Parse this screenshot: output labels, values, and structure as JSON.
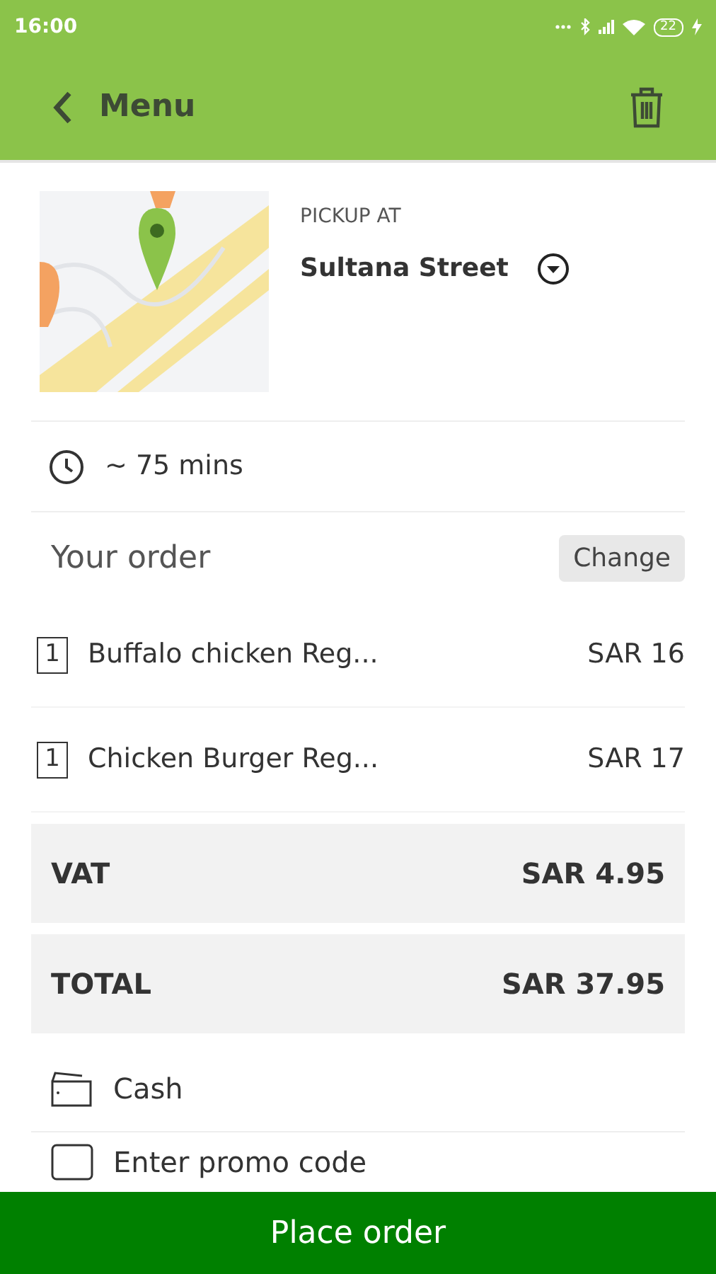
{
  "status_bar": {
    "time": "16:00",
    "battery": "22"
  },
  "header": {
    "back_label": "Menu"
  },
  "pickup": {
    "label": "PICKUP AT",
    "location": "Sultana Street"
  },
  "eta": "~ 75 mins",
  "order": {
    "title": "Your order",
    "change_label": "Change",
    "items": [
      {
        "qty": "1",
        "name": "Buffalo chicken Reg...",
        "price": "SAR 16"
      },
      {
        "qty": "1",
        "name": "Chicken Burger Reg...",
        "price": "SAR 17"
      }
    ]
  },
  "totals": [
    {
      "label": "VAT",
      "value": "SAR 4.95"
    },
    {
      "label": "TOTAL",
      "value": "SAR 37.95"
    }
  ],
  "payment": {
    "method": "Cash"
  },
  "promo": {
    "placeholder": "Enter promo code"
  },
  "place_order": "Place order"
}
